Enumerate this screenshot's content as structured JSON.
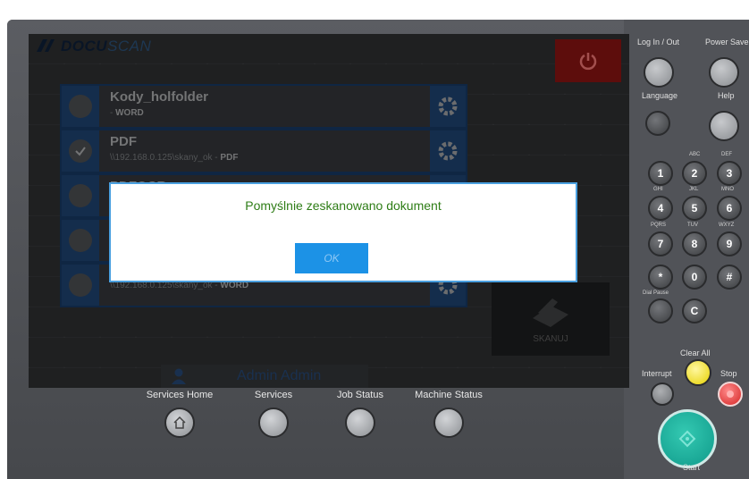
{
  "screen": {
    "brand": {
      "bold": "DOCU",
      "light": "SCAN"
    },
    "profiles": [
      {
        "name": "Kody_holfolder",
        "path": "",
        "format": "WORD",
        "selected": false
      },
      {
        "name": "PDF",
        "path": "\\\\192.168.0.125\\skany_ok",
        "format": "PDF",
        "selected": true
      },
      {
        "name": "PDFOCR",
        "path": "",
        "format": "",
        "selected": false
      },
      {
        "name": "",
        "path": "",
        "format": "",
        "selected": false
      },
      {
        "name": "",
        "path": "\\\\192.168.0.125\\skany_ok",
        "format": "WORD",
        "selected": false
      }
    ],
    "separator": " - ",
    "scan_label": "SKANUJ",
    "user_name": "Admin Admin",
    "dialog": {
      "message": "Pomyślnie zeskanowano dokument",
      "ok_label": "OK"
    }
  },
  "device_buttons": {
    "services_home": "Services Home",
    "services": "Services",
    "job_status": "Job Status",
    "machine_status": "Machine Status"
  },
  "keypad": {
    "log_in_out": "Log In / Out",
    "power_saver": "Power Saver",
    "language": "Language",
    "help": "Help",
    "keys": [
      "1",
      "2",
      "3",
      "4",
      "5",
      "6",
      "7",
      "8",
      "9",
      "*",
      "0",
      "#"
    ],
    "letters": {
      "2": "ABC",
      "3": "DEF",
      "4": "GHI",
      "5": "JKL",
      "6": "MNO",
      "7": "PQRS",
      "8": "TUV",
      "9": "WXYZ"
    },
    "dial_pause": "Dial Pause",
    "c_key": "C",
    "clear_all": "Clear All",
    "interrupt": "Interrupt",
    "stop": "Stop",
    "start": "Start"
  },
  "colors": {
    "accent": "#1c92e6",
    "success_text": "#2e7d16",
    "power": "#7d1210",
    "start": "#1aa896"
  }
}
